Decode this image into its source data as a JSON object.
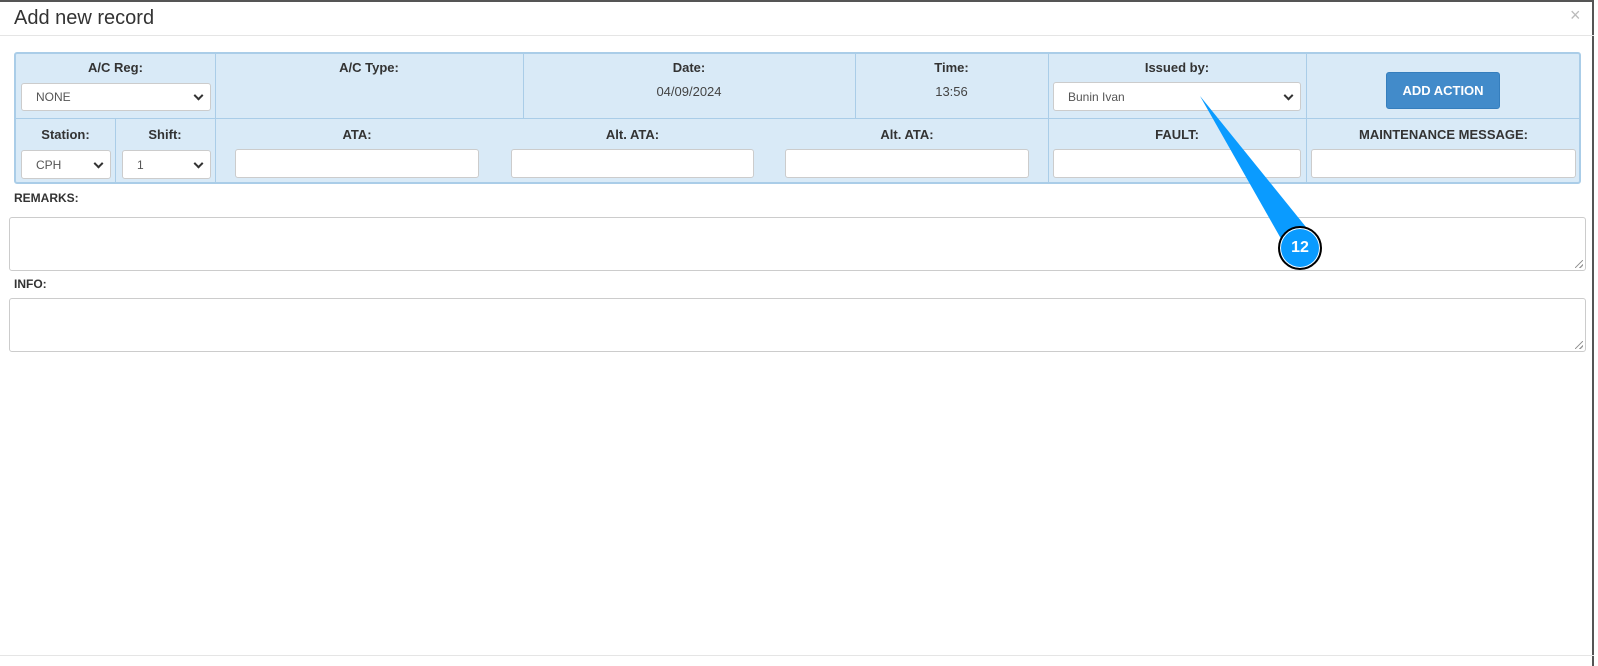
{
  "dialog": {
    "title": "Add new record",
    "close": "×"
  },
  "fields": {
    "ac_reg": {
      "label": "A/C Reg:",
      "value": "NONE"
    },
    "ac_type": {
      "label": "A/C Type:"
    },
    "date": {
      "label": "Date:",
      "value": "04/09/2024"
    },
    "time": {
      "label": "Time:",
      "value": "13:56"
    },
    "issued_by": {
      "label": "Issued by:",
      "value": "Bunin Ivan"
    },
    "add_action": "ADD ACTION",
    "station": {
      "label": "Station:",
      "value": "CPH"
    },
    "shift": {
      "label": "Shift:",
      "value": "1"
    },
    "ata": {
      "label": "ATA:"
    },
    "alt_ata_1": {
      "label": "Alt. ATA:"
    },
    "alt_ata_2": {
      "label": "Alt. ATA:"
    },
    "fault": {
      "label": "FAULT:"
    },
    "maintenance_message": {
      "label": "MAINTENANCE MESSAGE:"
    }
  },
  "remarks": {
    "label": "REMARKS:"
  },
  "info": {
    "label": "INFO:"
  },
  "annotation": {
    "number": "12",
    "color": "#0a9bff"
  }
}
